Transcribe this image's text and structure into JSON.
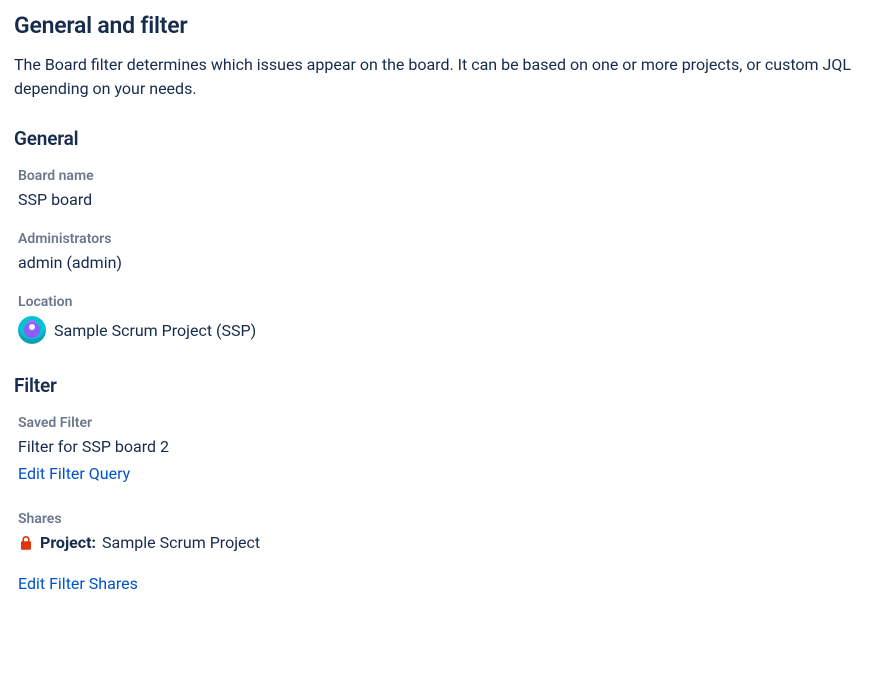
{
  "page": {
    "title": "General and filter",
    "description": "The Board filter determines which issues appear on the board. It can be based on one or more projects, or custom JQL depending on your needs."
  },
  "general": {
    "heading": "General",
    "board_name_label": "Board name",
    "board_name_value": "SSP board",
    "administrators_label": "Administrators",
    "administrators_value": "admin (admin)",
    "location_label": "Location",
    "location_value": "Sample Scrum Project (SSP)"
  },
  "filter": {
    "heading": "Filter",
    "saved_filter_label": "Saved Filter",
    "saved_filter_value": "Filter for SSP board 2",
    "edit_query_link": "Edit Filter Query",
    "shares_label": "Shares",
    "shares_type_label": "Project:",
    "shares_value": "Sample Scrum Project",
    "edit_shares_link": "Edit Filter Shares"
  },
  "colors": {
    "lock_icon": "#DE350B"
  }
}
